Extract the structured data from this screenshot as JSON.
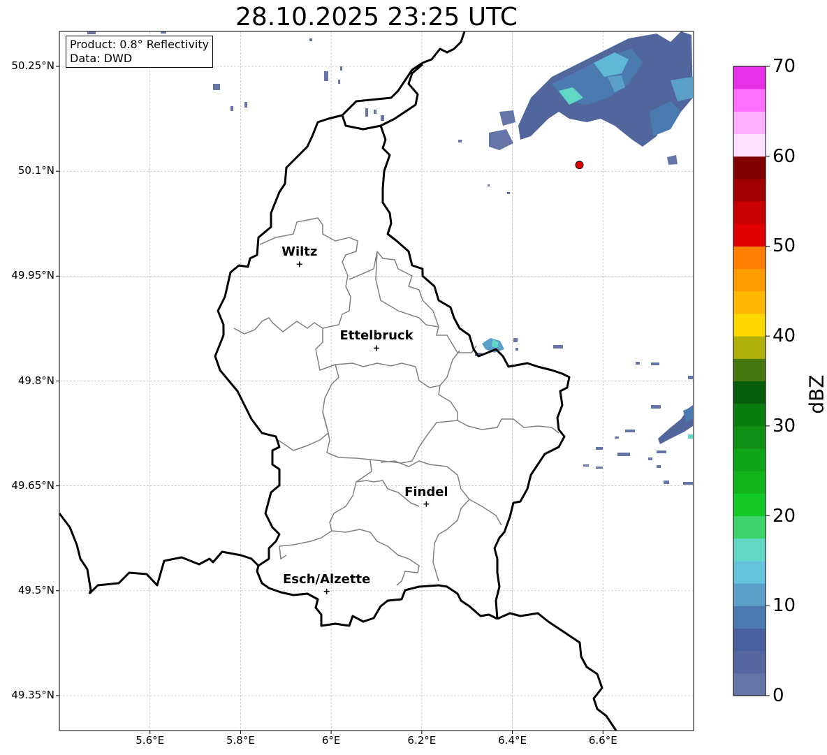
{
  "title": "28.10.2025 23:25 UTC",
  "info": {
    "product": "Product: 0.8° Reflectivity",
    "data": "Data: DWD"
  },
  "map": {
    "lat_range": [
      49.3,
      50.3
    ],
    "lon_range": [
      5.4,
      6.8
    ],
    "lat_ticks": [
      "50.25°N",
      "50.1°N",
      "49.95°N",
      "49.8°N",
      "49.65°N",
      "49.5°N",
      "49.35°N"
    ],
    "lon_ticks": [
      "5.6°E",
      "5.8°E",
      "6°E",
      "6.2°E",
      "6.4°E",
      "6.6°E"
    ],
    "gridlines": true
  },
  "places": [
    {
      "name": "Wiltz",
      "lon": 5.93,
      "lat": 49.967
    },
    {
      "name": "Ettelbruck",
      "lon": 6.1,
      "lat": 49.847
    },
    {
      "name": "Findel",
      "lon": 6.21,
      "lat": 49.624
    },
    {
      "name": "Esch/Alzette",
      "lon": 5.99,
      "lat": 49.499
    }
  ],
  "marker": {
    "lon": 6.548,
    "lat": 50.109,
    "color": "#e00000"
  },
  "colorbar": {
    "unit": "dBZ",
    "min": 0,
    "max": 70,
    "tick_labels": [
      "0",
      "10",
      "20",
      "30",
      "40",
      "50",
      "60",
      "70"
    ],
    "colors": [
      "#6575a8",
      "#5566a0",
      "#4860a0",
      "#4a7ab0",
      "#5aa0c8",
      "#65c4dc",
      "#62d8c4",
      "#3ed46c",
      "#14c828",
      "#12b41c",
      "#10a418",
      "#0f9014",
      "#0b7c10",
      "#055e0a",
      "#467810",
      "#b0b008",
      "#ffd800",
      "#ffb800",
      "#ff9c00",
      "#ff8000",
      "#e00000",
      "#c80000",
      "#a00000",
      "#800000",
      "#ffe0ff",
      "#ffb0ff",
      "#ff70ff",
      "#e830e8"
    ]
  }
}
